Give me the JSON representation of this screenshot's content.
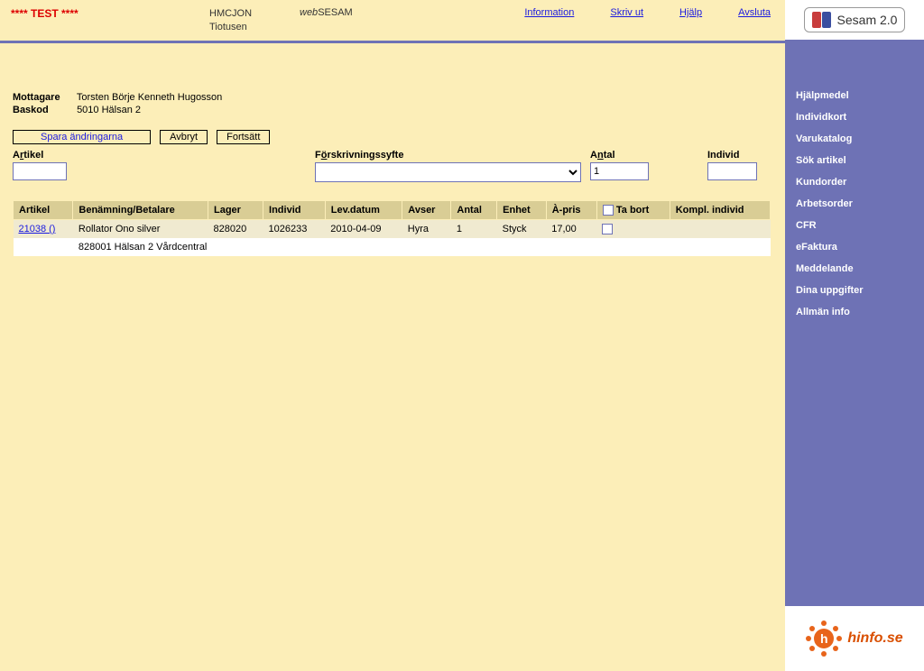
{
  "topbar": {
    "test_label": "**** TEST ****",
    "user_line1": "HMCJON",
    "user_line2": "Tiotusen",
    "app_web": "web",
    "app_name": "SESAM",
    "links": {
      "information": "Information",
      "skriv_ut": "Skriv ut",
      "hjalp": "Hjälp",
      "avsluta": "Avsluta"
    }
  },
  "info": {
    "mottagare_label": "Mottagare",
    "mottagare_value": "Torsten Börje Kenneth Hugosson",
    "baskod_label": "Baskod",
    "baskod_value": "5010 Hälsan 2"
  },
  "buttons": {
    "spara": "Spara ändringarna",
    "avbryt": "Avbryt",
    "fortsatt": "Fortsätt"
  },
  "form": {
    "artikel_prefix": "A",
    "artikel_u": "r",
    "artikel_suffix": "tikel",
    "artikel_value": "",
    "syfte_prefix": "F",
    "syfte_u": "ö",
    "syfte_suffix": "rskrivningssyfte",
    "antal_prefix": "A",
    "antal_u": "n",
    "antal_suffix": "tal",
    "antal_value": "1",
    "individ_label": "Individ",
    "individ_value": ""
  },
  "table": {
    "headers": {
      "artikel": "Artikel",
      "benamning": "Benämning/Betalare",
      "lager": "Lager",
      "individ": "Individ",
      "levdatum": "Lev.datum",
      "avser": "Avser",
      "antal": "Antal",
      "enhet": "Enhet",
      "apris": "À-pris",
      "tabort": "Ta bort",
      "kompl": "Kompl. individ"
    },
    "row": {
      "artikel": "21038 ()",
      "benamning": "Rollator Ono silver",
      "lager": "828020",
      "individ": "1026233",
      "levdatum": "2010-04-09",
      "avser": "Hyra",
      "antal": "1",
      "enhet": "Styck",
      "apris": "17,00"
    },
    "subrow": "828001 Hälsan 2 Vårdcentral"
  },
  "sidebar": {
    "logo_text": "Sesam 2.0",
    "items": [
      "Hjälpmedel",
      "Individkort",
      "Varukatalog",
      "Sök artikel",
      "Kundorder",
      "Arbetsorder",
      "CFR",
      "eFaktura",
      "Meddelande",
      "Dina uppgifter",
      "Allmän info"
    ],
    "footer_h": "h",
    "footer_text": "hinfo.se"
  }
}
